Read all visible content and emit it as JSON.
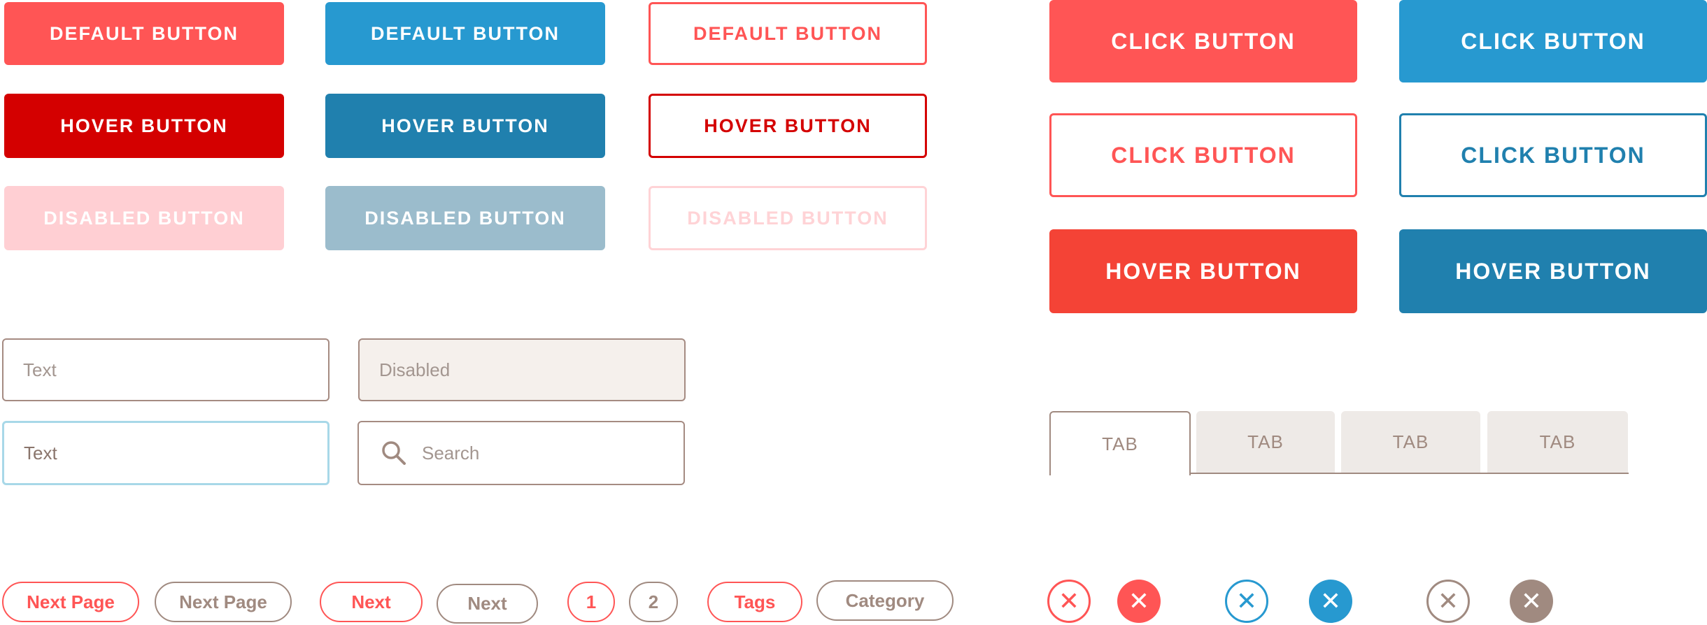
{
  "buttons": {
    "default": "DEFAULT BUTTON",
    "hover": "HOVER BUTTON",
    "disabled": "DISABLED BUTTON",
    "click": "CLICK BUTTON"
  },
  "inputs": {
    "text_placeholder": "Text",
    "disabled_placeholder": "Disabled",
    "focused_value": "Text",
    "search_placeholder": "Search"
  },
  "tabs": [
    "TAB",
    "TAB",
    "TAB",
    "TAB"
  ],
  "pills": {
    "next_page": "Next Page",
    "next": "Next",
    "page1": "1",
    "page2": "2",
    "tags": "Tags",
    "category": "Category"
  },
  "close_glyph": "✕",
  "colors": {
    "red": "#ff5555",
    "blue": "#2799d0",
    "dark_red": "#d40000",
    "dark_blue": "#2080ae",
    "brown": "#a08a80"
  }
}
